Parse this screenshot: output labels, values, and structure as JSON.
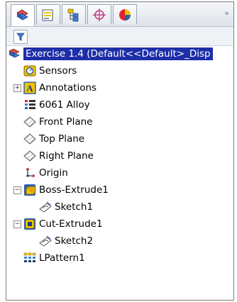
{
  "tabs": [
    {
      "icon": "featuremanager-icon"
    },
    {
      "icon": "propertymanager-icon"
    },
    {
      "icon": "configurationmanager-icon"
    },
    {
      "icon": "dimxpert-icon"
    },
    {
      "icon": "displaymanager-icon"
    }
  ],
  "tab_overflow": "»",
  "tree": {
    "root": "Exercise 1.4  (Default<<Default>_Disp",
    "items": [
      {
        "label": "Sensors",
        "icon": "sensors-icon"
      },
      {
        "label": "Annotations",
        "icon": "annotations-icon"
      },
      {
        "label": "6061 Alloy",
        "icon": "material-icon"
      },
      {
        "label": "Front Plane",
        "icon": "plane-icon"
      },
      {
        "label": "Top Plane",
        "icon": "plane-icon"
      },
      {
        "label": "Right Plane",
        "icon": "plane-icon"
      },
      {
        "label": "Origin",
        "icon": "origin-icon"
      },
      {
        "label": "Boss-Extrude1",
        "icon": "boss-extrude-icon"
      },
      {
        "label": "Sketch1",
        "icon": "sketch-icon"
      },
      {
        "label": "Cut-Extrude1",
        "icon": "cut-extrude-icon"
      },
      {
        "label": "Sketch2",
        "icon": "sketch-icon"
      },
      {
        "label": "LPattern1",
        "icon": "linear-pattern-icon"
      }
    ]
  },
  "toggles": {
    "plus": "+",
    "minus": "−"
  },
  "colors": {
    "selection": "#1c2ea8",
    "accent_blue": "#2a5db0",
    "accent_yellow": "#f2c200"
  }
}
